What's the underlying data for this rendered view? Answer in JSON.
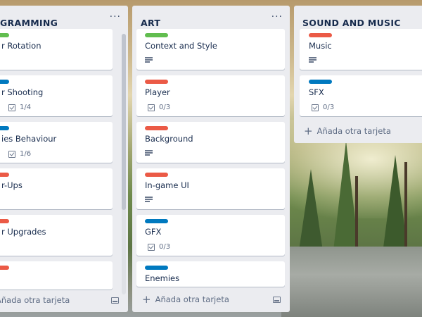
{
  "colors": {
    "green": "#61bd4f",
    "red": "#eb5a46",
    "blue": "#0079bf",
    "list_bg": "#ebecf0",
    "text": "#172b4d"
  },
  "menu_glyph": "···",
  "add_card_label": "Añada otra tarjeta",
  "lists": [
    {
      "title": "GRAMMING",
      "cards": [
        {
          "label_color": "green",
          "title": "r Rotation"
        },
        {
          "label_color": "blue",
          "title": "r Shooting",
          "checklist": "1/4"
        },
        {
          "label_color": "blue",
          "title": "ies Behaviour",
          "checklist": "1/6"
        },
        {
          "label_color": "red",
          "title": "r-Ups"
        },
        {
          "label_color": "red",
          "title": "r Upgrades"
        },
        {
          "label_color": "red",
          "title": ""
        }
      ]
    },
    {
      "title": "ART",
      "cards": [
        {
          "label_color": "green",
          "title": "Context and Style",
          "description": true
        },
        {
          "label_color": "red",
          "title": "Player",
          "checklist": "0/3"
        },
        {
          "label_color": "red",
          "title": "Background",
          "description": true
        },
        {
          "label_color": "red",
          "title": "In-game UI",
          "description": true
        },
        {
          "label_color": "blue",
          "title": "GFX",
          "checklist": "0/3"
        },
        {
          "label_color": "blue",
          "title": "Enemies"
        }
      ]
    },
    {
      "title": "SOUND AND MUSIC",
      "cards": [
        {
          "label_color": "red",
          "title": "Music",
          "description": true
        },
        {
          "label_color": "blue",
          "title": "SFX",
          "checklist": "0/3"
        }
      ]
    }
  ]
}
